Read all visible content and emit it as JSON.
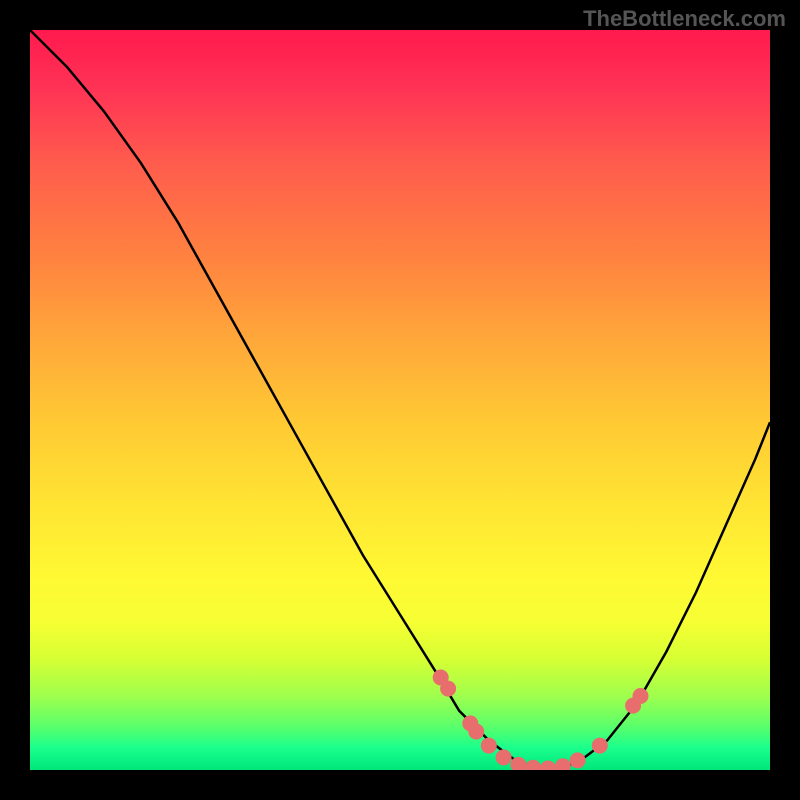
{
  "watermark": "TheBottleneck.com",
  "chart_data": {
    "type": "line",
    "title": "",
    "xlabel": "",
    "ylabel": "",
    "xlim": [
      0,
      100
    ],
    "ylim": [
      0,
      100
    ],
    "curve": {
      "x": [
        0,
        5,
        10,
        15,
        20,
        25,
        30,
        35,
        40,
        45,
        50,
        55,
        58,
        62,
        66,
        70,
        74,
        78,
        82,
        86,
        90,
        94,
        98,
        100
      ],
      "y": [
        100,
        95,
        89,
        82,
        74,
        65,
        56,
        47,
        38,
        29,
        21,
        13,
        8,
        4,
        1,
        0,
        1,
        4,
        9,
        16,
        24,
        33,
        42,
        47
      ]
    },
    "points": [
      {
        "x": 55.5,
        "y": 12.5
      },
      {
        "x": 56.5,
        "y": 11.0
      },
      {
        "x": 59.5,
        "y": 6.3
      },
      {
        "x": 60.3,
        "y": 5.2
      },
      {
        "x": 62.0,
        "y": 3.3
      },
      {
        "x": 64.0,
        "y": 1.7
      },
      {
        "x": 66.0,
        "y": 0.7
      },
      {
        "x": 68.0,
        "y": 0.3
      },
      {
        "x": 70.0,
        "y": 0.2
      },
      {
        "x": 72.0,
        "y": 0.5
      },
      {
        "x": 74.0,
        "y": 1.3
      },
      {
        "x": 77.0,
        "y": 3.3
      },
      {
        "x": 81.5,
        "y": 8.7
      },
      {
        "x": 82.5,
        "y": 10.0
      }
    ],
    "colors": {
      "line": "#000000",
      "point": "#e86d6d"
    }
  }
}
